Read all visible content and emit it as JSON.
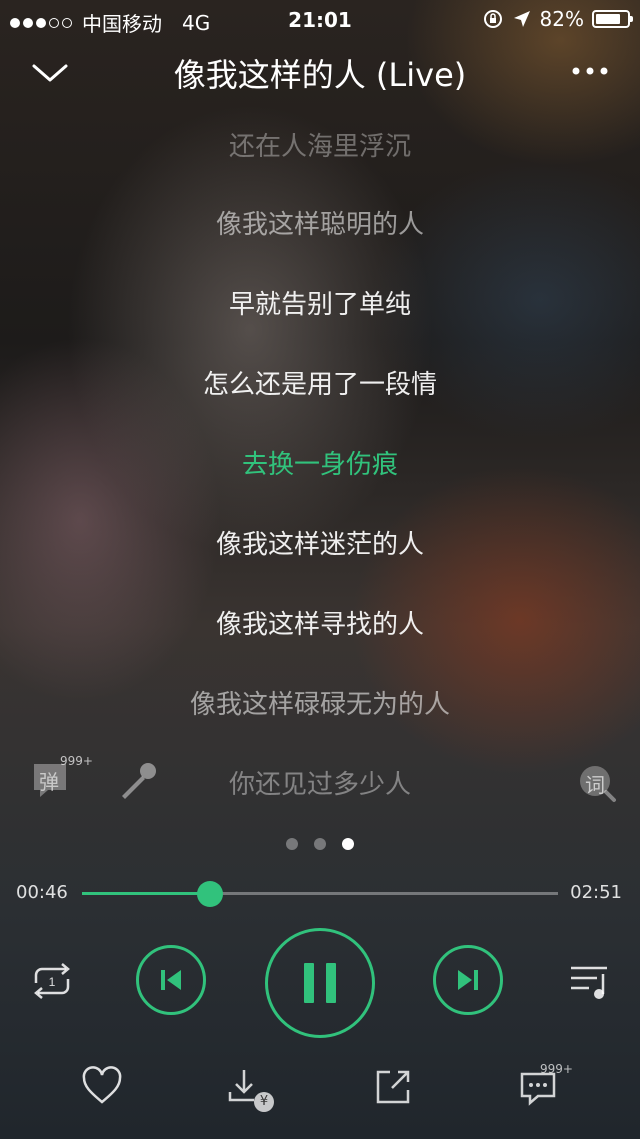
{
  "status_bar": {
    "carrier": "中国移动",
    "network": "4G",
    "time": "21:01",
    "battery_percent": "82%",
    "battery_level": 0.82
  },
  "header": {
    "title": "像我这样的人 (Live)",
    "collapse_icon": "chevron-down-icon",
    "more_icon": "more-dots-icon"
  },
  "lyrics": [
    "还在人海里浮沉",
    "像我这样聪明的人",
    "早就告别了单纯",
    "怎么还是用了一段情",
    "去换一身伤痕",
    "像我这样迷茫的人",
    "像我这样寻找的人",
    "像我这样碌碌无为的人",
    "你还见过多少人"
  ],
  "active_lyric_index": 4,
  "side_controls": {
    "danmu_label": "弹",
    "danmu_badge": "999+",
    "lyric_button_label": "词"
  },
  "pager": {
    "count": 3,
    "active": 2
  },
  "progress": {
    "current": "00:46",
    "total": "02:51",
    "fraction": 0.269
  },
  "colors": {
    "accent": "#31c27c"
  },
  "bottom_bar": {
    "comment_badge": "999+",
    "download_badge": "¥"
  }
}
